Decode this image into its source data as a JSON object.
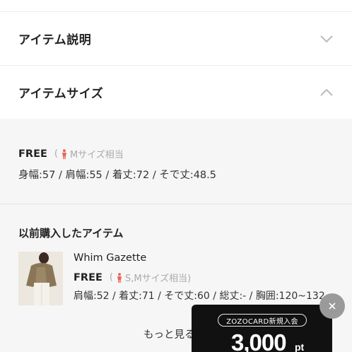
{
  "accordion": {
    "description_label": "アイテム説明",
    "size_label": "アイテムサイズ"
  },
  "size": {
    "free_label": "FREE",
    "equiv": "Mサイズ相当",
    "equiv_open": "(",
    "dimensions": "身幅:57 / 肩幅:55 / 着丈:72 / そで丈:48.5"
  },
  "purchased": {
    "title": "以前購入したアイテム",
    "item": {
      "brand": "Whim Gazette",
      "free_label": "FREE",
      "equiv_open": "(",
      "equiv": "S,Mサイズ相当)",
      "dimensions": "肩幅:52 / 着丈:71 / そで丈:60 / 総丈:- / 胸囲:120~132"
    },
    "more_label": "もっと見る"
  },
  "promo": {
    "badge": "ZOZOCARD新規入会",
    "amount": "3,000",
    "unit": "pt"
  },
  "colors": {
    "panel_bg": "#f6f6f6",
    "person_icon": "#e8645a",
    "promo_bg": "#111111"
  }
}
